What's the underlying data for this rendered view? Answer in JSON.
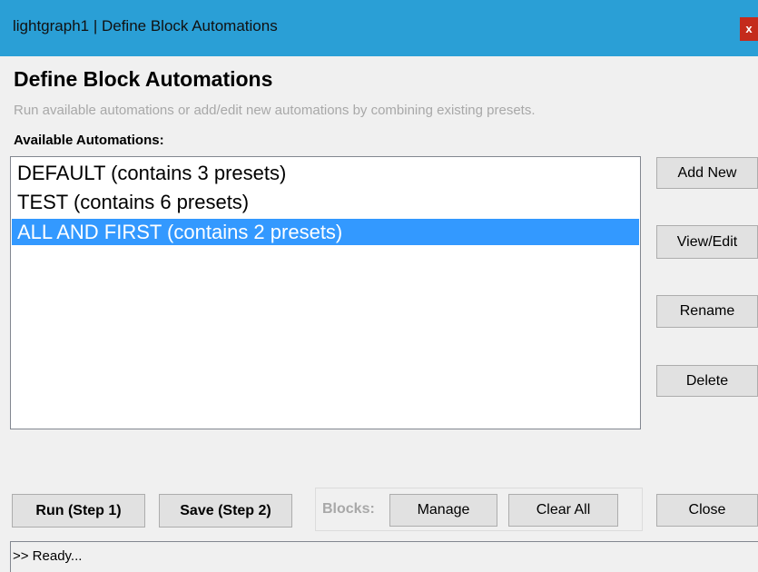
{
  "window": {
    "title": "lightgraph1 | Define Block Automations",
    "close_label": "x"
  },
  "header": {
    "title": "Define Block Automations",
    "subtitle": "Run available automations or add/edit new automations by combining existing presets."
  },
  "automations": {
    "label": "Available Automations:",
    "items": [
      {
        "label": "DEFAULT (contains 3 presets)",
        "selected": false
      },
      {
        "label": "TEST (contains 6 presets)",
        "selected": false
      },
      {
        "label": "ALL AND FIRST (contains 2 presets)",
        "selected": true
      }
    ]
  },
  "side_buttons": {
    "add_new": "Add New",
    "view_edit": "View/Edit",
    "rename": "Rename",
    "delete": "Delete"
  },
  "bottom": {
    "run": "Run (Step 1)",
    "save": "Save (Step 2)",
    "blocks_label": "Blocks:",
    "manage": "Manage",
    "clear_all": "Clear All",
    "close": "Close"
  },
  "status": {
    "text": ">> Ready..."
  },
  "colors": {
    "titlebar": "#2a9fd6",
    "selection": "#3399ff",
    "close_button": "#c42b1c"
  }
}
